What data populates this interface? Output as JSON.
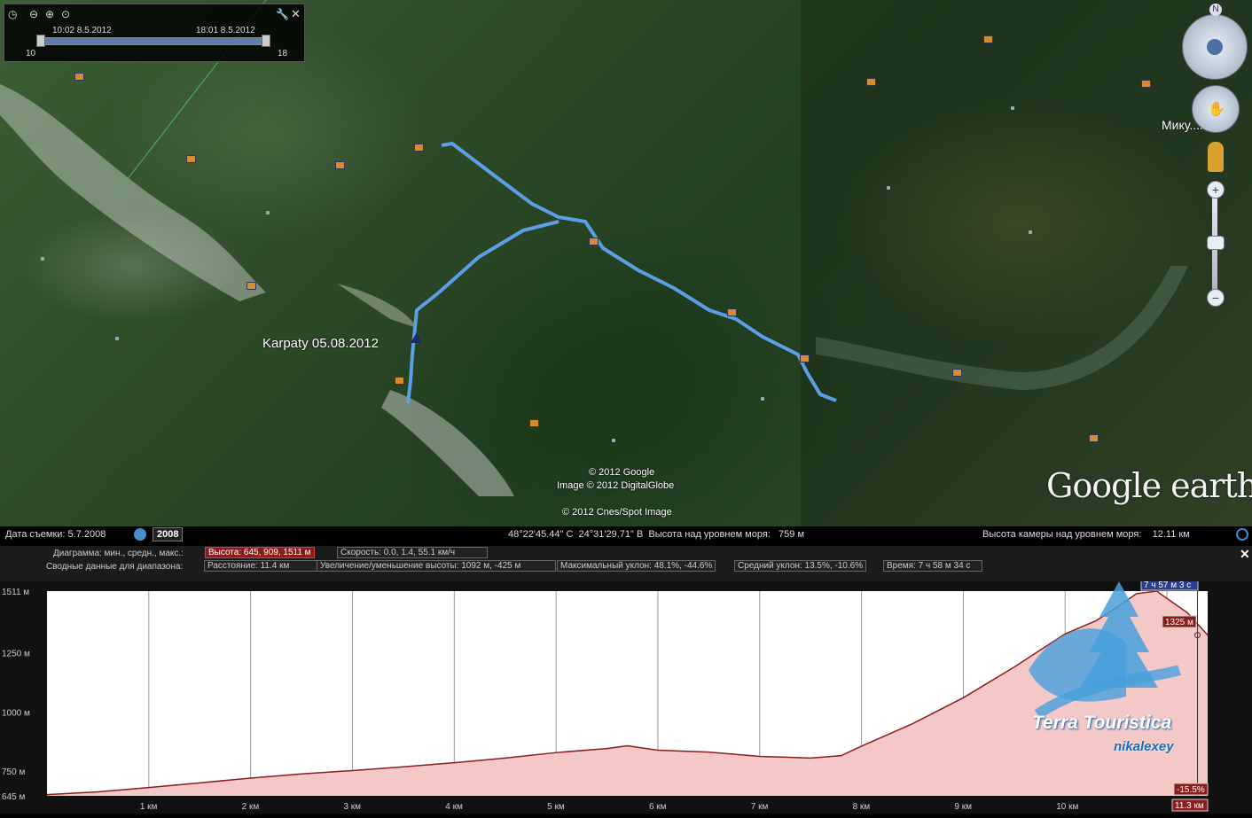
{
  "time_slider": {
    "start_label": "10:02 8.5.2012",
    "end_label": "18:01 8.5.2012",
    "min": "10",
    "max": "18"
  },
  "map": {
    "track_label": "Karpaty 05.08.2012",
    "town_label": "Мику...нин",
    "copyright_1": "© 2012 Google",
    "copyright_2": "Image © 2012 DigitalGlobe",
    "copyright_3": "© 2012 Cnes/Spot Image",
    "logo": "Google earth",
    "track_color": "#5aa0e6"
  },
  "status": {
    "date_label": "Дата съемки: 5.7.2008",
    "year": "2008",
    "coords": "48°22'45.44\" С  24°31'29.71\" В  Высота над уровнем моря:   759 м",
    "camera": "Высота камеры над уровнем моря:    12.11 км"
  },
  "stats": {
    "row1_label": "Диаграмма: мин., средн., макс.:",
    "height": "Высота: 645, 909, 1511 м",
    "speed": "Скорость: 0.0, 1.4, 55.1 км/ч",
    "row2_label": "Сводные данные для диапазона:",
    "distance": "Расстояние: 11.4 км",
    "gain": "Увеличение/уменьшение высоты: 1092 м, -425 м",
    "max_slope": "Максимальный уклон: 48.1%, -44.6%",
    "avg_slope": "Средний уклон: 13.5%, -10.6%",
    "time": "Время: 7 ч 58 м 34 с"
  },
  "chart_data": {
    "type": "area",
    "xlabel": "",
    "ylabel": "",
    "y_ticks": [
      "1511 м",
      "1250 м",
      "1000 м",
      "750 м",
      "645 м"
    ],
    "x_ticks": [
      "1 км",
      "2 км",
      "3 км",
      "4 км",
      "5 км",
      "6 км",
      "7 км",
      "8 км",
      "9 км",
      "10 км"
    ],
    "xlim": [
      0,
      11.4
    ],
    "ylim": [
      645,
      1511
    ],
    "x": [
      0,
      0.5,
      1,
      1.5,
      2,
      2.5,
      3,
      3.5,
      4,
      4.5,
      5,
      5.5,
      5.7,
      6,
      6.5,
      7,
      7.5,
      7.8,
      8,
      8.5,
      9,
      9.5,
      10,
      10.3,
      10.5,
      10.7,
      10.9,
      11,
      11.2,
      11.4
    ],
    "y": [
      650,
      662,
      680,
      700,
      720,
      738,
      752,
      768,
      785,
      805,
      828,
      845,
      857,
      838,
      830,
      812,
      805,
      815,
      855,
      950,
      1060,
      1190,
      1330,
      1385,
      1440,
      1500,
      1511,
      1480,
      1420,
      1325
    ],
    "cursor_time": "7 ч 57 м 3 с",
    "cursor_height": "1325 м",
    "cursor_slope": "-15.5%",
    "cursor_distance": "11.3 км",
    "fill_color": "#f5c8c8",
    "line_color": "#8b1c1c"
  },
  "watermark": {
    "title": "Terra Touristica",
    "subtitle": "nikalexey"
  }
}
